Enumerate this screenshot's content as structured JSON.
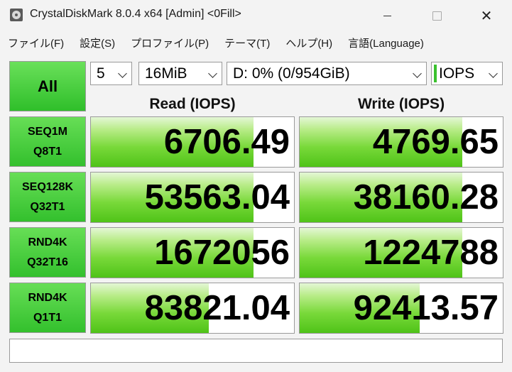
{
  "window": {
    "title": "CrystalDiskMark 8.0.4 x64 [Admin] <0Fill>",
    "minimize_label": "—",
    "close_label": "✕"
  },
  "menu": [
    {
      "label": "ファイル(F)"
    },
    {
      "label": "設定(S)"
    },
    {
      "label": "プロファイル(P)"
    },
    {
      "label": "テーマ(T)"
    },
    {
      "label": "ヘルプ(H)"
    },
    {
      "label": "言語(Language)"
    }
  ],
  "controls": {
    "all_label": "All",
    "count": "5",
    "size": "16MiB",
    "drive": "D: 0% (0/954GiB)",
    "unit": "IOPS"
  },
  "headers": {
    "read": "Read (IOPS)",
    "write": "Write (IOPS)"
  },
  "tests": [
    {
      "line1": "SEQ1M",
      "line2": "Q8T1",
      "read": "6706.49",
      "write": "4769.65",
      "read_fill": 0.8,
      "write_fill": 0.8
    },
    {
      "line1": "SEQ128K",
      "line2": "Q32T1",
      "read": "53563.04",
      "write": "38160.28",
      "read_fill": 0.8,
      "write_fill": 0.8
    },
    {
      "line1": "RND4K",
      "line2": "Q32T16",
      "read": "1672056",
      "write": "1224788",
      "read_fill": 0.8,
      "write_fill": 0.8
    },
    {
      "line1": "RND4K",
      "line2": "Q1T1",
      "read": "83821.04",
      "write": "92413.57",
      "read_fill": 0.58,
      "write_fill": 0.59
    }
  ],
  "status_text": "",
  "colors": {
    "accent_green": "#3ac12e",
    "border_gray": "#9a9a9a"
  }
}
